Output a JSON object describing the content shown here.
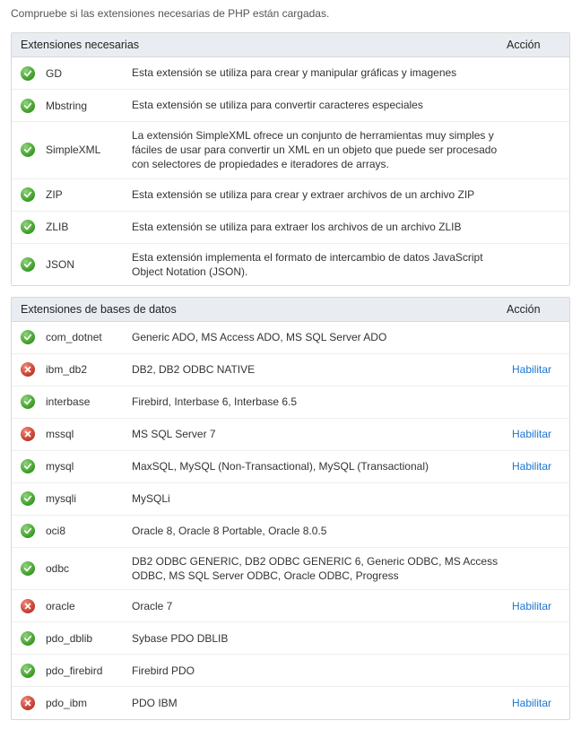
{
  "intro": "Compruebe si las extensiones necesarias de PHP están cargadas.",
  "action_label": "Acción",
  "enable_label": "Habilitar",
  "required": {
    "title": "Extensiones necesarias",
    "items": [
      {
        "name": "GD",
        "desc": "Esta extensión se utiliza para crear y manipular gráficas y imagenes",
        "ok": true
      },
      {
        "name": "Mbstring",
        "desc": "Esta extensión se utiliza para convertir caracteres especiales",
        "ok": true
      },
      {
        "name": "SimpleXML",
        "desc": "La extensión SimpleXML ofrece un conjunto de herramientas muy simples y fáciles de usar para convertir un XML en un objeto que puede ser procesado con selectores de propiedades e iteradores de arrays.",
        "ok": true
      },
      {
        "name": "ZIP",
        "desc": "Esta extensión se utiliza para crear y extraer archivos de un archivo ZIP",
        "ok": true
      },
      {
        "name": "ZLIB",
        "desc": "Esta extensión se utiliza para extraer los archivos de un archivo ZLIB",
        "ok": true
      },
      {
        "name": "JSON",
        "desc": "Esta extensión implementa el formato de intercambio de datos JavaScript Object Notation (JSON).",
        "ok": true
      }
    ]
  },
  "database": {
    "title": "Extensiones de bases de datos",
    "items": [
      {
        "name": "com_dotnet",
        "desc": "Generic ADO, MS Access ADO, MS SQL Server ADO",
        "ok": true,
        "enable": false
      },
      {
        "name": "ibm_db2",
        "desc": "DB2, DB2 ODBC NATIVE",
        "ok": false,
        "enable": true
      },
      {
        "name": "interbase",
        "desc": "Firebird, Interbase 6, Interbase 6.5",
        "ok": true,
        "enable": false
      },
      {
        "name": "mssql",
        "desc": "MS SQL Server 7",
        "ok": false,
        "enable": true
      },
      {
        "name": "mysql",
        "desc": "MaxSQL, MySQL (Non-Transactional), MySQL (Transactional)",
        "ok": true,
        "enable": true
      },
      {
        "name": "mysqli",
        "desc": "MySQLi",
        "ok": true,
        "enable": false
      },
      {
        "name": "oci8",
        "desc": "Oracle 8, Oracle 8 Portable, Oracle 8.0.5",
        "ok": true,
        "enable": false
      },
      {
        "name": "odbc",
        "desc": "DB2 ODBC GENERIC, DB2 ODBC GENERIC 6, Generic ODBC, MS Access ODBC, MS SQL Server ODBC, Oracle ODBC, Progress",
        "ok": true,
        "enable": false
      },
      {
        "name": "oracle",
        "desc": "Oracle 7",
        "ok": false,
        "enable": true
      },
      {
        "name": "pdo_dblib",
        "desc": "Sybase PDO DBLIB",
        "ok": true,
        "enable": false
      },
      {
        "name": "pdo_firebird",
        "desc": "Firebird PDO",
        "ok": true,
        "enable": false
      },
      {
        "name": "pdo_ibm",
        "desc": "PDO IBM",
        "ok": false,
        "enable": true
      }
    ]
  }
}
